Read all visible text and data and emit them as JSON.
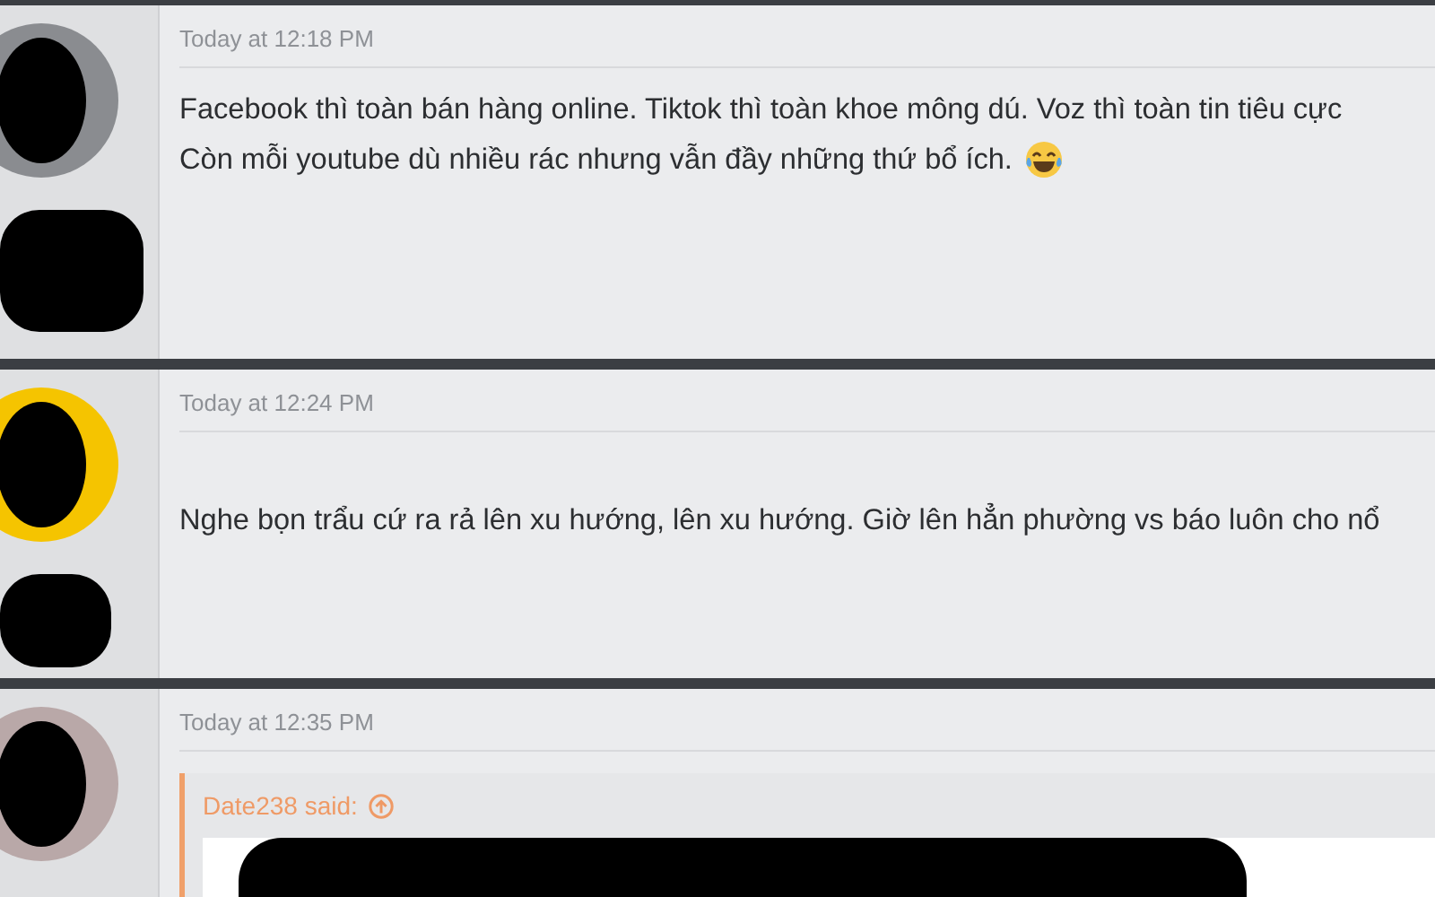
{
  "posts": [
    {
      "timestamp": "Today at 12:18 PM",
      "avatar": {
        "color": "#8a8c90"
      },
      "message_lines": [
        "Facebook thì toàn bán hàng online. Tiktok thì toàn khoe mông dú. Voz thì toàn tin tiêu cực",
        "Còn mỗi youtube dù nhiều rác nhưng vẫn đầy những thứ bổ ích."
      ],
      "trailing_emoji": true
    },
    {
      "timestamp": "Today at 12:24 PM",
      "avatar": {
        "color": "#f5c400"
      },
      "message_lines": [
        "Nghe bọn trẩu cứ ra rả lên xu hướng, lên xu hướng. Giờ lên hẳn phường vs báo luôn cho nổ"
      ]
    },
    {
      "timestamp": "Today at 12:35 PM",
      "avatar": {
        "color": "#b9a8a8"
      },
      "quote": {
        "attribution": "Date238 said:"
      }
    }
  ]
}
